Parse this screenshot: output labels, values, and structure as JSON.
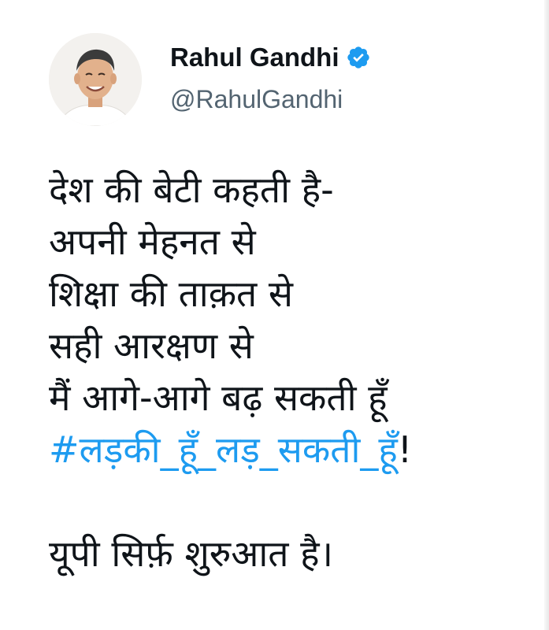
{
  "author": {
    "display_name": "Rahul Gandhi",
    "handle": "@RahulGandhi",
    "verified": true,
    "avatar_icon": "profile-photo"
  },
  "tweet": {
    "lines": [
      "देश की बेटी कहती है-",
      "अपनी मेहनत से",
      "शिक्षा की ताक़त से",
      "सही आरक्षण से",
      "मैं आगे-आगे बढ़ सकती हूँ"
    ],
    "hashtag": "#लड़की_हूँ_लड़_सकती_हूँ",
    "hashtag_suffix": "!",
    "closing": "यूपी सिर्फ़ शुरुआत है।"
  },
  "colors": {
    "text": "#0f1419",
    "secondary": "#536471",
    "link": "#1d9bf0",
    "verified_badge": "#1d9bf0"
  }
}
